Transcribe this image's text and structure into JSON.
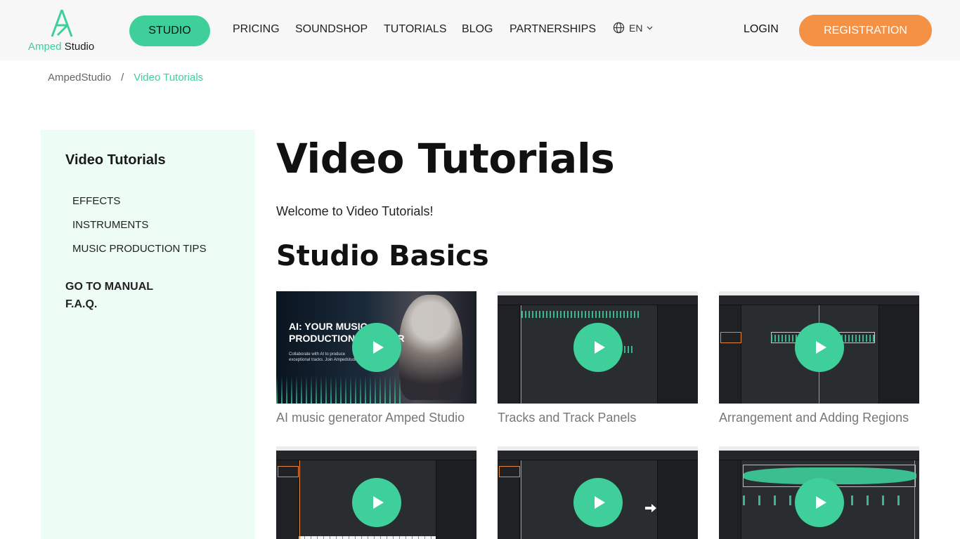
{
  "header": {
    "logo": {
      "word1": "Amped",
      "word2": "Studio"
    },
    "studio_button": "STUDIO",
    "nav": [
      "PRICING",
      "SOUNDSHOP",
      "TUTORIALS",
      "BLOG",
      "PARTNERSHIPS"
    ],
    "lang": "EN",
    "login": "LOGIN",
    "registration": "REGISTRATION"
  },
  "breadcrumb": {
    "home": "AmpedStudio",
    "separator": "/",
    "current": "Video Tutorials"
  },
  "sidebar": {
    "title": "Video Tutorials",
    "links": [
      "EFFECTS",
      "INSTRUMENTS",
      "MUSIC PRODUCTION TIPS"
    ],
    "manual": "GO TO MANUAL",
    "faq": "F.A.Q."
  },
  "main": {
    "title": "Video Tutorials",
    "welcome": "Welcome to Video Tutorials!",
    "section_title": "Studio Basics",
    "videos": [
      {
        "caption": "AI music generator Amped Studio",
        "thumb_title": "AI: YOUR MUSIC PRODUCTION PARTNER",
        "thumb_sub": "Collaborate with AI to produce exceptional tracks. Join Ampedstudio"
      },
      {
        "caption": "Tracks and Track Panels"
      },
      {
        "caption": "Arrangement and Adding Regions"
      },
      {
        "caption": ""
      },
      {
        "caption": ""
      },
      {
        "caption": ""
      }
    ]
  },
  "colors": {
    "accent": "#3ecf9b",
    "registration": "#f59145",
    "sidebar_bg": "#edfcf4"
  },
  "icons": {
    "globe": "globe-icon",
    "chevron": "chevron-down-icon",
    "play": "play-icon"
  }
}
